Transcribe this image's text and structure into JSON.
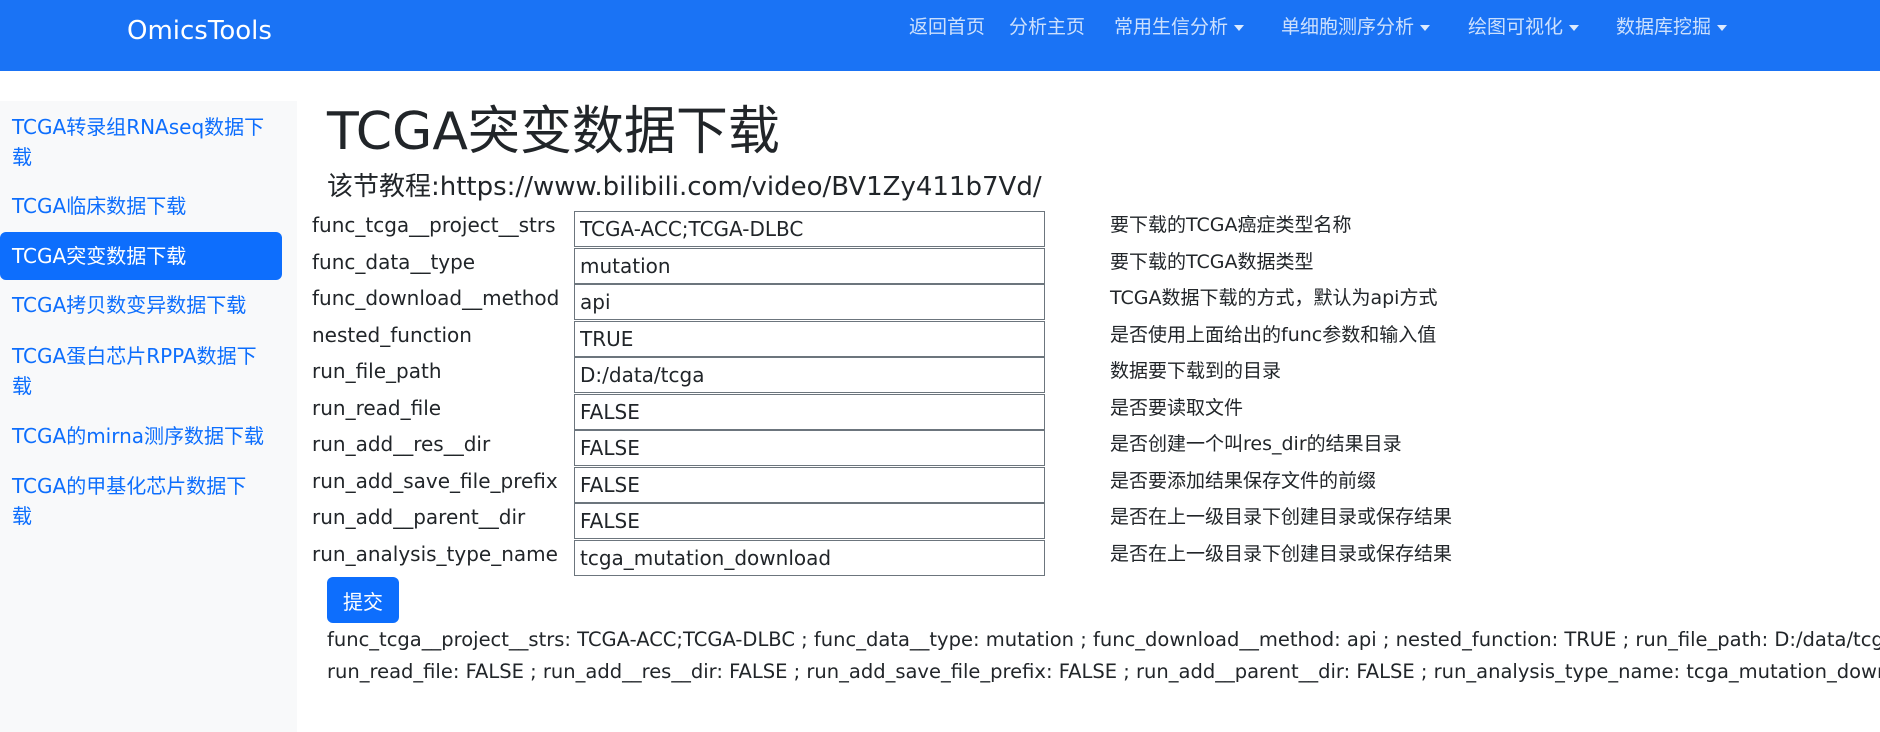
{
  "navbar": {
    "brand": "OmicsTools",
    "items": [
      {
        "label": "返回首页",
        "dropdown": false
      },
      {
        "label": "分析主页",
        "dropdown": false
      },
      {
        "label": "常用生信分析",
        "dropdown": true
      },
      {
        "label": "单细胞测序分析",
        "dropdown": true
      },
      {
        "label": "绘图可视化",
        "dropdown": true
      },
      {
        "label": "数据库挖掘",
        "dropdown": true
      }
    ]
  },
  "sidebar": {
    "items": [
      {
        "line1": "TCGA转录组RNAseq数据下",
        "line2": "载",
        "active": false
      },
      {
        "line1": "TCGA临床数据下载",
        "line2": "",
        "active": false
      },
      {
        "line1": "TCGA突变数据下载",
        "line2": "",
        "active": true
      },
      {
        "line1": "TCGA拷贝数变异数据下载",
        "line2": "",
        "active": false
      },
      {
        "line1": "TCGA蛋白芯片RPPA数据下",
        "line2": "载",
        "active": false
      },
      {
        "line1": "TCGA的mirna测序数据下载",
        "line2": "",
        "active": false
      },
      {
        "line1": "TCGA的甲基化芯片数据下",
        "line2": "载",
        "active": false
      }
    ]
  },
  "main": {
    "title": "TCGA突变数据下载",
    "tutorial": "该节教程:https://www.bilibili.com/video/BV1Zy411b7Vd/",
    "form": [
      {
        "label": "func_tcga__project__strs",
        "value": "TCGA-ACC;TCGA-DLBC",
        "desc": "要下载的TCGA癌症类型名称"
      },
      {
        "label": "func_data__type",
        "value": "mutation",
        "desc": "要下载的TCGA数据类型"
      },
      {
        "label": "func_download__method",
        "value": "api",
        "desc": "TCGA数据下载的方式，默认为api方式"
      },
      {
        "label": "nested_function",
        "value": "TRUE",
        "desc": "是否使用上面给出的func参数和输入值"
      },
      {
        "label": "run_file_path",
        "value": "D:/data/tcga",
        "desc": "数据要下载到的目录"
      },
      {
        "label": "run_read_file",
        "value": "FALSE",
        "desc": "是否要读取文件"
      },
      {
        "label": "run_add__res__dir",
        "value": "FALSE",
        "desc": "是否创建一个叫res_dir的结果目录"
      },
      {
        "label": "run_add_save_file_prefix",
        "value": "FALSE",
        "desc": "是否要添加结果保存文件的前缀"
      },
      {
        "label": "run_add__parent__dir",
        "value": "FALSE",
        "desc": "是否在上一级目录下创建目录或保存结果"
      },
      {
        "label": "run_analysis_type_name",
        "value": "tcga_mutation_download",
        "desc": "是否在上一级目录下创建目录或保存结果"
      }
    ],
    "submit_label": "提交",
    "result_line1": "func_tcga__project__strs: TCGA-ACC;TCGA-DLBC ; func_data__type: mutation ; func_download__method: api ; nested_function: TRUE ; run_file_path: D:/data/tcga ;",
    "result_line2": "run_read_file: FALSE ; run_add__res__dir: FALSE ; run_add_save_file_prefix: FALSE ; run_add__parent__dir: FALSE ; run_analysis_type_name: tcga_mutation_download"
  },
  "colors": {
    "navbar": "#1a73f5",
    "primary": "#0d6efd",
    "sidebar_bg": "#f8f9fa"
  }
}
